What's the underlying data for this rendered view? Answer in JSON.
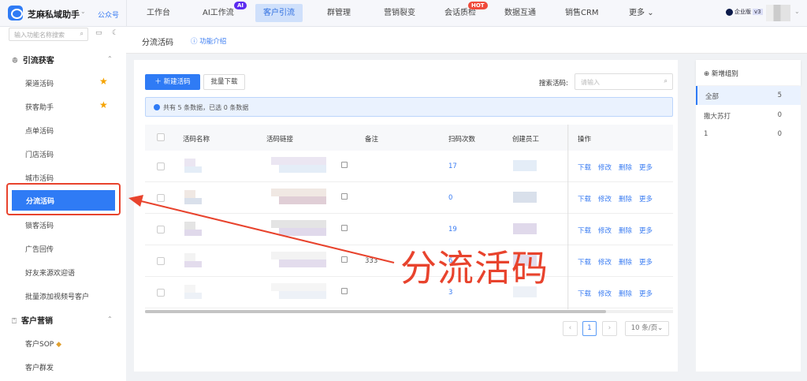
{
  "topbar": {
    "brand": "芝麻私域助手",
    "account_type": "公众号",
    "nav": [
      {
        "label": "工作台"
      },
      {
        "label": "AI工作流",
        "badge": "AI"
      },
      {
        "label": "客户引流",
        "active": true
      },
      {
        "label": "群管理"
      },
      {
        "label": "营销裂变"
      },
      {
        "label": "会话质检",
        "badge": "HOT"
      },
      {
        "label": "数据互通"
      },
      {
        "label": "销售CRM"
      },
      {
        "label": "更多"
      }
    ],
    "edition": "企业版",
    "version": "v3"
  },
  "sidebar": {
    "search_placeholder": "输入功能名称搜索",
    "groups": [
      {
        "label": "引流获客",
        "items": [
          "渠道活码",
          "获客助手",
          "点单活码",
          "门店活码",
          "城市活码",
          "分流活码",
          "锁客活码",
          "广告回传",
          "好友来源欢迎语",
          "批量添加视频号客户"
        ]
      },
      {
        "label": "客户营销",
        "items": [
          "客户SOP",
          "客户群发"
        ]
      }
    ],
    "active": "分流活码",
    "starred": [
      "渠道活码",
      "获客助手"
    ]
  },
  "page": {
    "title": "分流活码",
    "intro_link": "功能介绍"
  },
  "toolbar": {
    "new_label": "新建活码",
    "batch_download": "批量下载",
    "search_label": "搜索活码:",
    "search_placeholder": "请输入"
  },
  "alert": "共有 5 条数据，已选 0 条数据",
  "table": {
    "columns": [
      "活码名称",
      "活码链接",
      "备注",
      "扫码次数",
      "创建员工",
      "操作"
    ],
    "rows": [
      {
        "note": "",
        "scans": "17"
      },
      {
        "note": "",
        "scans": "0"
      },
      {
        "note": "",
        "scans": "19"
      },
      {
        "note": "333",
        "scans": "6"
      },
      {
        "note": "",
        "scans": "3"
      }
    ],
    "actions": [
      "下载",
      "修改",
      "删除",
      "更多"
    ]
  },
  "pagination": {
    "current": "1",
    "page_size": "10 条/页"
  },
  "groups_panel": {
    "add_label": "新增组别",
    "groups": [
      {
        "name": "全部",
        "count": "5",
        "active": true
      },
      {
        "name": "撒大苏打",
        "count": "0"
      },
      {
        "name": "1",
        "count": "0"
      }
    ]
  },
  "annotation": {
    "text": "分流活码",
    "color": "#e8432d"
  },
  "colors": {
    "accent": "#2f7bf5",
    "annotation": "#e8432d",
    "star": "#f5a300"
  }
}
